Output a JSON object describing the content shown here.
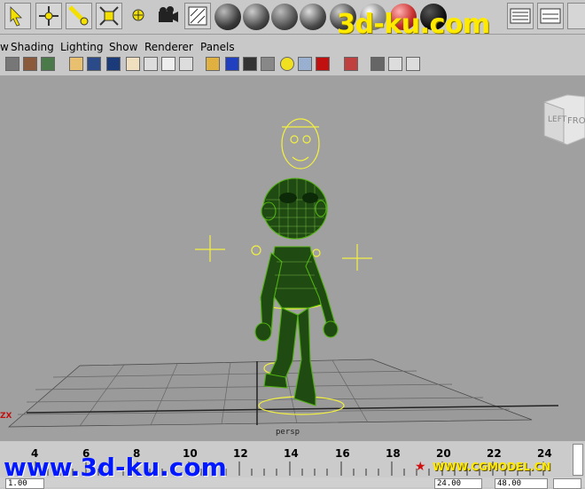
{
  "shelf": {
    "tools": [
      "select-tool-icon",
      "move-tool-icon",
      "rotate-tool-icon",
      "scale-tool-icon",
      "universal-manip-icon",
      "camera-tool-icon",
      "render-view-icon"
    ],
    "material_spheres": [
      "#3a3a3a",
      "#4a4a4a",
      "#505050",
      "#4a4a4a",
      "#454545",
      "#6b6b6b",
      "#c83030",
      "#101010"
    ]
  },
  "watermark_top": "3d-ku.com",
  "menu": {
    "items": [
      "w",
      "Shading",
      "Lighting",
      "Show",
      "Renderer",
      "Panels"
    ]
  },
  "toolbar": {
    "icons": [
      "camera-icon",
      "bookmark-icon",
      "image-plane-icon",
      "grid-toggle-icon",
      "resolution-gate-icon",
      "film-gate-icon",
      "safe-action-icon",
      "wireframe-icon",
      "smooth-shade-icon",
      "texture-icon",
      "light-icon",
      "shadow-icon",
      "xray-icon",
      "isolate-icon",
      "frame-all-icon",
      "frame-selected-icon",
      "hud-icon"
    ]
  },
  "viewport": {
    "camera_label": "persp",
    "viewcube_left": "LEFT",
    "viewcube_front": "FRO",
    "axis_label": "ZX"
  },
  "timeslider": {
    "ticks": [
      "4",
      "6",
      "8",
      "10",
      "12",
      "14",
      "16",
      "18",
      "20",
      "22",
      "24"
    ]
  },
  "range": {
    "start": "1.00",
    "end_current": "24.00",
    "end_max": "48.00"
  },
  "watermark_bottom": "www.3d-ku.com",
  "watermark_cg": "WWW.CGMODEL.CN"
}
